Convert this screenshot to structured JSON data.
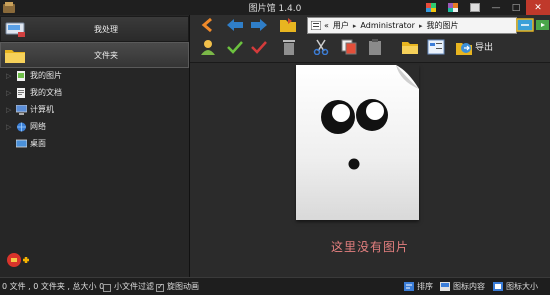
{
  "window": {
    "title": "图片馆 1.4.0",
    "controls": [
      "—",
      "□",
      "✕"
    ]
  },
  "sidebar": {
    "nav_buttons": [
      {
        "label": "我处理",
        "icon": "scanner-icon"
      },
      {
        "label": "文件夹",
        "icon": "folder-icon"
      }
    ],
    "tree": [
      {
        "label": "我的图片",
        "icon": "pictures-folder-icon"
      },
      {
        "label": "我的文档",
        "icon": "documents-folder-icon"
      },
      {
        "label": "计算机",
        "icon": "computer-icon"
      },
      {
        "label": "网络",
        "icon": "network-icon"
      },
      {
        "label": "桌面",
        "icon": "desktop-icon"
      }
    ]
  },
  "toolbar": {
    "address": {
      "prefix": "«",
      "parts": [
        "用户",
        "Administrator",
        "我的图片"
      ]
    },
    "export_label": "导出"
  },
  "main": {
    "empty_message": "这里没有图片"
  },
  "status": {
    "summary": "0 文件 , 0 文件夹 , 总大小 0",
    "small_file_filter": "小文件过滤",
    "rotate_animation": "旋图动画",
    "sort_label": "排序",
    "icon_content_label": "图标内容",
    "icon_size_label": "图标大小"
  },
  "colors": {
    "accent_text": "#e47f7f",
    "close_button": "#c0392b"
  }
}
